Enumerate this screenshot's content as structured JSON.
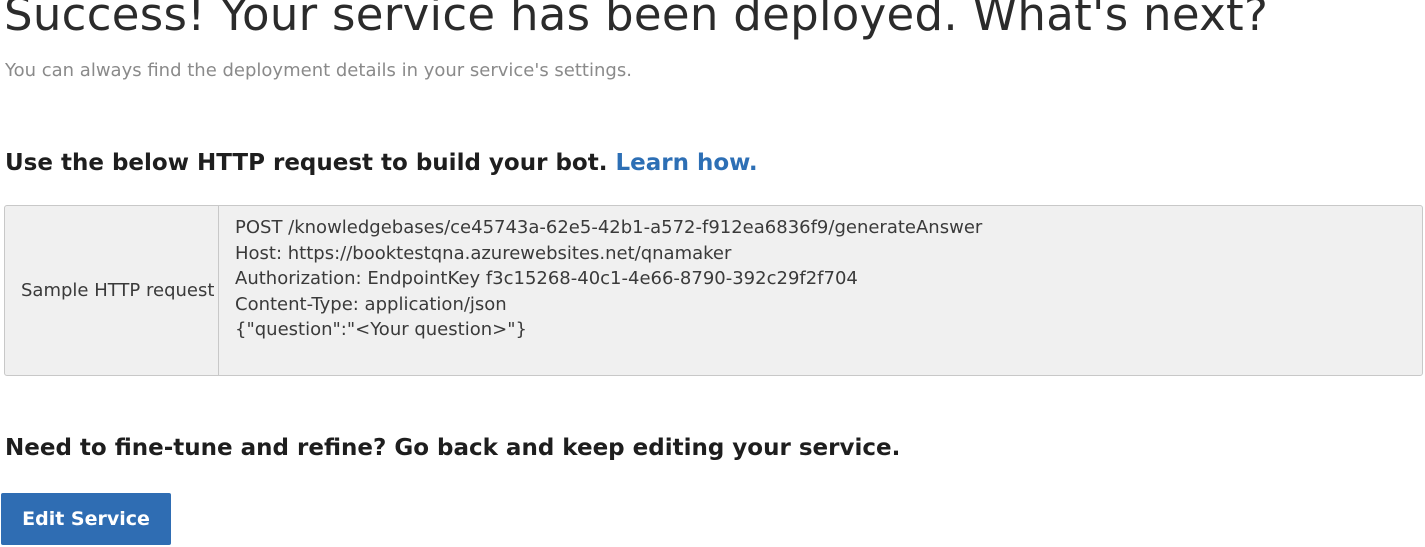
{
  "header": {
    "title": "Success! Your service has been deployed. What's next?",
    "subtitle": "You can always find the deployment details in your service's settings."
  },
  "build_section": {
    "heading": "Use the below HTTP request to build your bot.",
    "link_label": "Learn how."
  },
  "request": {
    "label": "Sample HTTP request",
    "lines": [
      "POST /knowledgebases/ce45743a-62e5-42b1-a572-f912ea6836f9/generateAnswer",
      "Host: https://booktestqna.azurewebsites.net/qnamaker",
      "Authorization: EndpointKey f3c15268-40c1-4e66-8790-392c29f2f704",
      "Content-Type: application/json",
      "{\"question\":\"<Your question>\"}"
    ]
  },
  "refine_section": {
    "heading": "Need to fine-tune and refine? Go back and keep editing your service."
  },
  "actions": {
    "edit_label": "Edit Service"
  },
  "colors": {
    "accent": "#2f6db3",
    "link": "#2d6fb5",
    "box_background": "#f0f0f0",
    "muted_text": "#8a8a8a"
  }
}
